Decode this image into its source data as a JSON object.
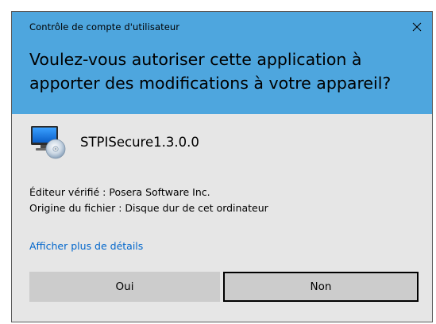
{
  "dialog": {
    "title": "Contrôle de compte d'utilisateur",
    "close_icon": "close-icon",
    "question": "Voulez-vous autoriser cette application à apporter des modifications à votre appareil?",
    "header_color": "#4ea6de",
    "body_color": "#e6e6e6"
  },
  "app": {
    "icon": "monitor-cd-icon",
    "name": "STPISecure1.3.0.0"
  },
  "details": {
    "publisher": "Éditeur vérifié : Posera Software Inc.",
    "origin": "Origine du fichier : Disque dur de cet ordinateur"
  },
  "more_details_link": "Afficher plus de détails",
  "buttons": {
    "yes": "Oui",
    "no": "Non"
  },
  "link_color": "#0066cc"
}
